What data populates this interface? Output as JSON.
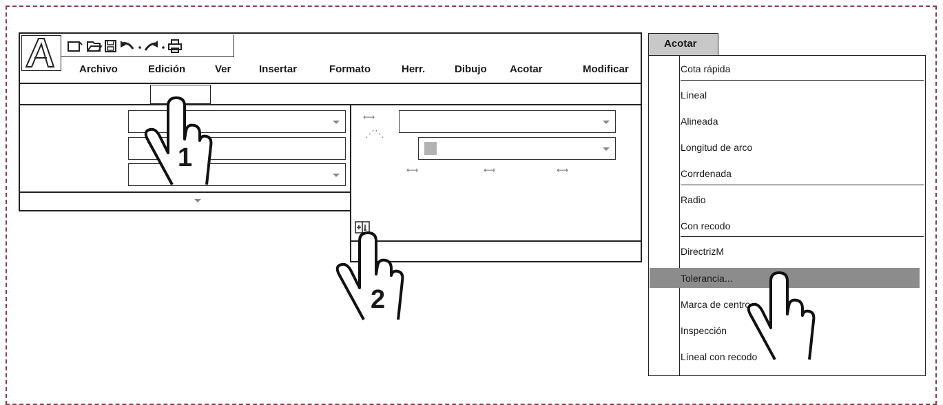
{
  "app": {
    "logo_letter": "A"
  },
  "toolbar": {
    "icons": [
      "new-file-icon",
      "open-folder-icon",
      "save-icon",
      "undo-icon",
      "redo-icon",
      "print-icon"
    ]
  },
  "menubar": {
    "items": [
      "Archivo",
      "Edición",
      "Ver",
      "Insertar",
      "Formato",
      "Herr.",
      "Dibujo",
      "Acotar",
      "Modificar"
    ]
  },
  "dropdown": {
    "tab_label": "Acotar",
    "items": [
      "Cota rápida",
      "Líneal",
      "Alineada",
      "Longitud de arco",
      "Corrdenada",
      "Radio",
      "Con recodo",
      "DirectrizM",
      "Tolerancia...",
      "Marca de centro",
      "Inspección",
      "Líneal con recodo"
    ],
    "highlighted_item": "Tolerancia...",
    "highlight_color": "#8c8c8c"
  },
  "steps": {
    "step1": "1",
    "step2": "2"
  },
  "colors": {
    "frame_dash": "#8a3a50",
    "swatch": "#b3b3b3"
  }
}
